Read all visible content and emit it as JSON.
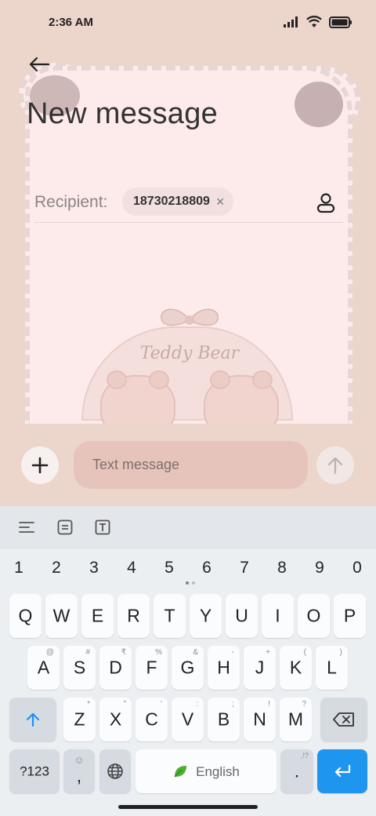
{
  "status": {
    "time": "2:36 AM"
  },
  "header": {
    "title": "New message"
  },
  "recipient": {
    "label": "Recipient:",
    "number": "18730218809",
    "remove_glyph": "×"
  },
  "illustration": {
    "text": "Teddy Bear"
  },
  "composer": {
    "placeholder": "Text message"
  },
  "keyboard": {
    "numbers": [
      "1",
      "2",
      "3",
      "4",
      "5",
      "6",
      "7",
      "8",
      "9",
      "0"
    ],
    "row1": [
      {
        "key": "Q",
        "hint": ""
      },
      {
        "key": "W",
        "hint": ""
      },
      {
        "key": "E",
        "hint": ""
      },
      {
        "key": "R",
        "hint": ""
      },
      {
        "key": "T",
        "hint": ""
      },
      {
        "key": "Y",
        "hint": ""
      },
      {
        "key": "U",
        "hint": ""
      },
      {
        "key": "I",
        "hint": ""
      },
      {
        "key": "O",
        "hint": ""
      },
      {
        "key": "P",
        "hint": ""
      }
    ],
    "row2": [
      {
        "key": "A",
        "hint": "@"
      },
      {
        "key": "S",
        "hint": "#"
      },
      {
        "key": "D",
        "hint": "₹"
      },
      {
        "key": "F",
        "hint": "%"
      },
      {
        "key": "G",
        "hint": "&"
      },
      {
        "key": "H",
        "hint": "-"
      },
      {
        "key": "J",
        "hint": "+"
      },
      {
        "key": "K",
        "hint": "("
      },
      {
        "key": "L",
        "hint": ")"
      }
    ],
    "row3": [
      {
        "key": "Z",
        "hint": "*"
      },
      {
        "key": "X",
        "hint": "\""
      },
      {
        "key": "C",
        "hint": "'"
      },
      {
        "key": "V",
        "hint": ":"
      },
      {
        "key": "B",
        "hint": ";"
      },
      {
        "key": "N",
        "hint": "!"
      },
      {
        "key": "M",
        "hint": "?"
      }
    ],
    "symbols_label": "?123",
    "comma_label": ",",
    "space_label": "English",
    "period_label": ".",
    "period_hint": ",!?"
  }
}
